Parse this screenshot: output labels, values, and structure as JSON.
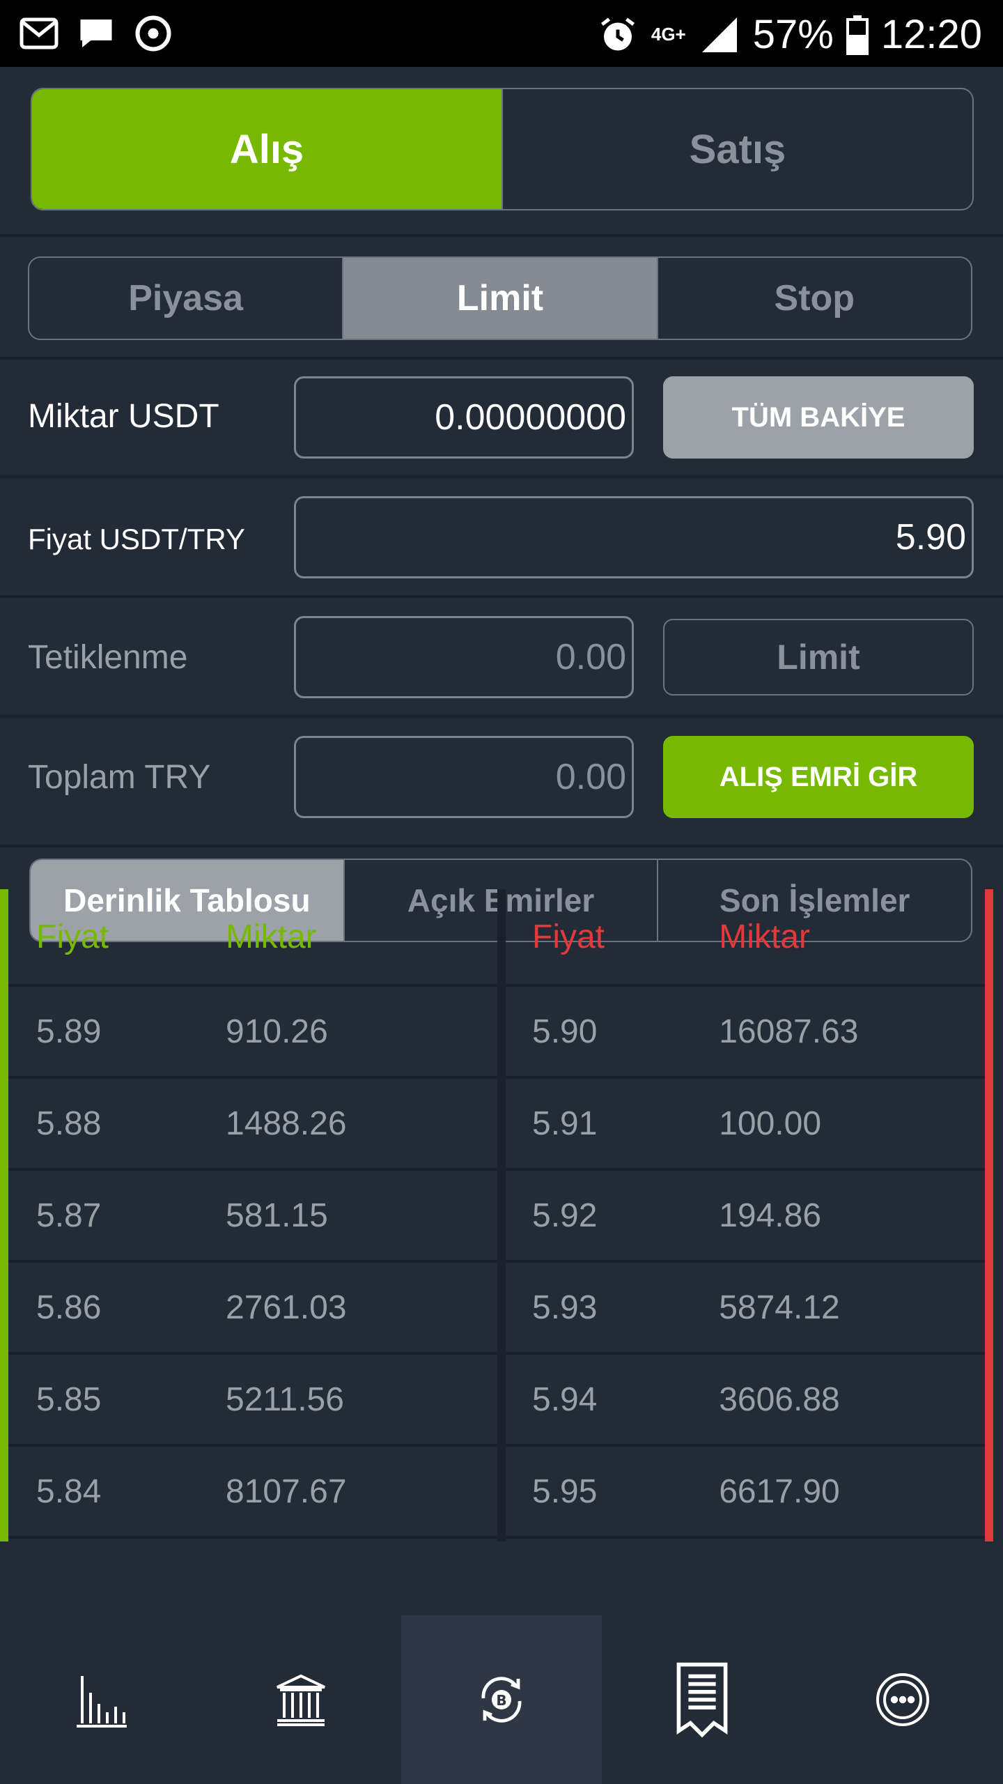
{
  "status_bar": {
    "network": "4G+",
    "battery": "57%",
    "time": "12:20"
  },
  "trade_side": {
    "buy_label": "Alış",
    "sell_label": "Satış"
  },
  "order_type": {
    "market_label": "Piyasa",
    "limit_label": "Limit",
    "stop_label": "Stop"
  },
  "form": {
    "amount_label": "Miktar USDT",
    "amount_value": "0.00000000",
    "all_balance_label": "TÜM BAKİYE",
    "price_label": "Fiyat USDT/TRY",
    "price_value": "5.90",
    "trigger_label": "Tetiklenme",
    "trigger_value": "0.00",
    "trigger_type_label": "Limit",
    "total_label": "Toplam TRY",
    "total_value": "0.00",
    "submit_label": "ALIŞ EMRİ GİR"
  },
  "tabs": {
    "depth_label": "Derinlik Tablosu",
    "open_orders_label": "Açık Emirler",
    "recent_trades_label": "Son İşlemler"
  },
  "depth": {
    "price_header": "Fiyat",
    "amount_header": "Miktar",
    "bids": [
      {
        "price": "5.89",
        "amount": "910.26"
      },
      {
        "price": "5.88",
        "amount": "1488.26"
      },
      {
        "price": "5.87",
        "amount": "581.15"
      },
      {
        "price": "5.86",
        "amount": "2761.03"
      },
      {
        "price": "5.85",
        "amount": "5211.56"
      },
      {
        "price": "5.84",
        "amount": "8107.67"
      }
    ],
    "asks": [
      {
        "price": "5.90",
        "amount": "16087.63"
      },
      {
        "price": "5.91",
        "amount": "100.00"
      },
      {
        "price": "5.92",
        "amount": "194.86"
      },
      {
        "price": "5.93",
        "amount": "5874.12"
      },
      {
        "price": "5.94",
        "amount": "3606.88"
      },
      {
        "price": "5.95",
        "amount": "6617.90"
      }
    ]
  },
  "colors": {
    "accent_green": "#76b900",
    "ask_red": "#e03a3a",
    "background": "#232b37"
  },
  "nav_icons": [
    "chart-icon",
    "bank-icon",
    "bitcoin-exchange-icon",
    "receipt-icon",
    "more-icon"
  ]
}
